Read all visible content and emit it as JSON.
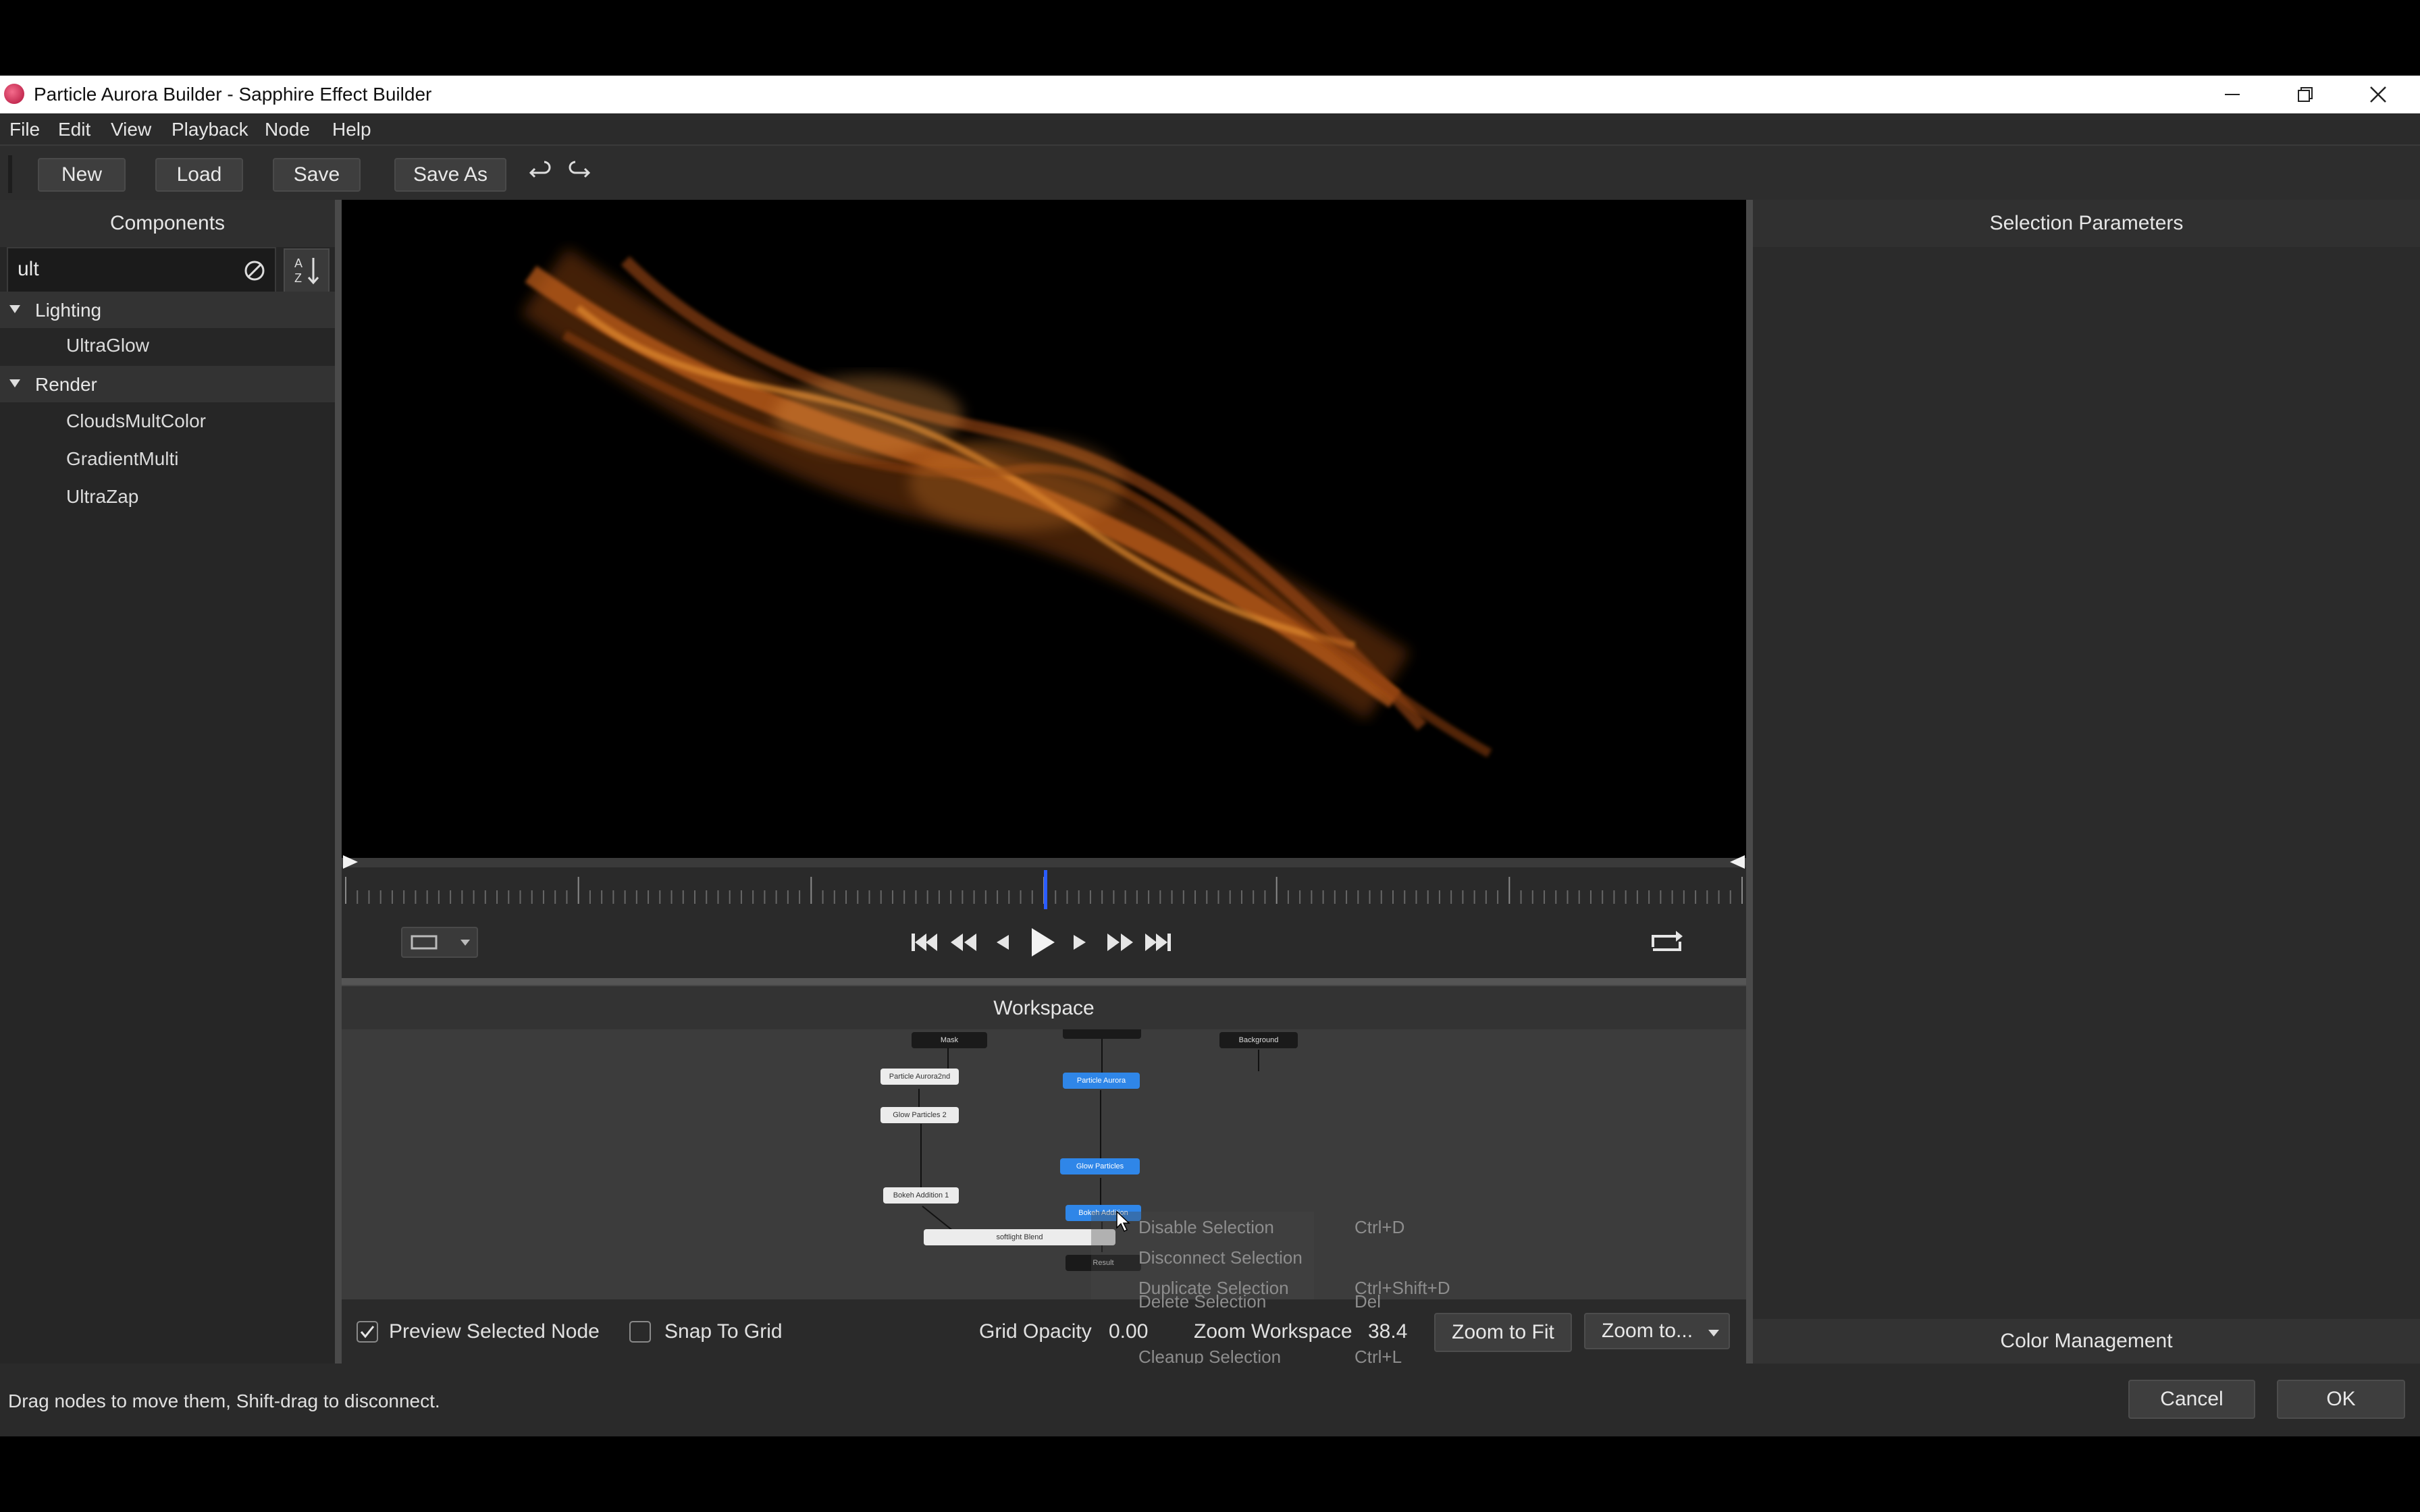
{
  "window": {
    "title": "Particle Aurora Builder - Sapphire Effect Builder"
  },
  "menu": [
    "File",
    "Edit",
    "View",
    "Playback",
    "Node",
    "Help"
  ],
  "toolbar": {
    "new": "New",
    "load": "Load",
    "save": "Save",
    "save_as": "Save As"
  },
  "components": {
    "header": "Components",
    "search_value": "ult",
    "categories": [
      {
        "label": "Lighting",
        "items": [
          "UltraGlow"
        ]
      },
      {
        "label": "Render",
        "items": [
          "CloudsMultColor",
          "GradientMulti",
          "UltraZap"
        ]
      }
    ]
  },
  "workspace": {
    "header": "Workspace",
    "nodes": {
      "mask": "Mask",
      "particle_aurora_2nd": "Particle Aurora2nd",
      "glow_particles_2": "Glow Particles 2",
      "bokeh_addition_1": "Bokeh Addition 1",
      "softlight_blend": "softlight Blend",
      "particle_aurora": "Particle Aurora",
      "glow_particles": "Glow Particles",
      "bokeh_addition": "Bokeh Addition",
      "result": "Result",
      "background": "Background"
    },
    "context_menu": [
      {
        "label": "Disable Selection",
        "shortcut": "Ctrl+D"
      },
      {
        "label": "Disconnect Selection",
        "shortcut": ""
      },
      {
        "label": "Duplicate Selection",
        "shortcut": "Ctrl+Shift+D"
      },
      {
        "label": "Delete Selection",
        "shortcut": "Del"
      },
      {
        "label": "Cleanup Selection",
        "shortcut": "Ctrl+L"
      }
    ]
  },
  "bottom": {
    "preview_selected_node": "Preview Selected Node",
    "preview_checked": true,
    "snap_to_grid": "Snap To Grid",
    "snap_checked": false,
    "grid_opacity_label": "Grid Opacity",
    "grid_opacity_value": "0.00",
    "zoom_workspace_label": "Zoom Workspace",
    "zoom_workspace_value": "38.4",
    "zoom_to_fit": "Zoom to Fit",
    "zoom_to": "Zoom to..."
  },
  "right_panel": {
    "selection_parameters": "Selection Parameters",
    "color_management": "Color Management"
  },
  "status": {
    "hint": "Drag nodes to move them, Shift-drag to disconnect."
  },
  "dialog": {
    "cancel": "Cancel",
    "ok": "OK"
  },
  "timeline": {
    "playhead_fraction": 0.5
  },
  "colors": {
    "accent": "#2f86e8",
    "panel": "#2b2b2b",
    "aurora": "#c8621a"
  }
}
